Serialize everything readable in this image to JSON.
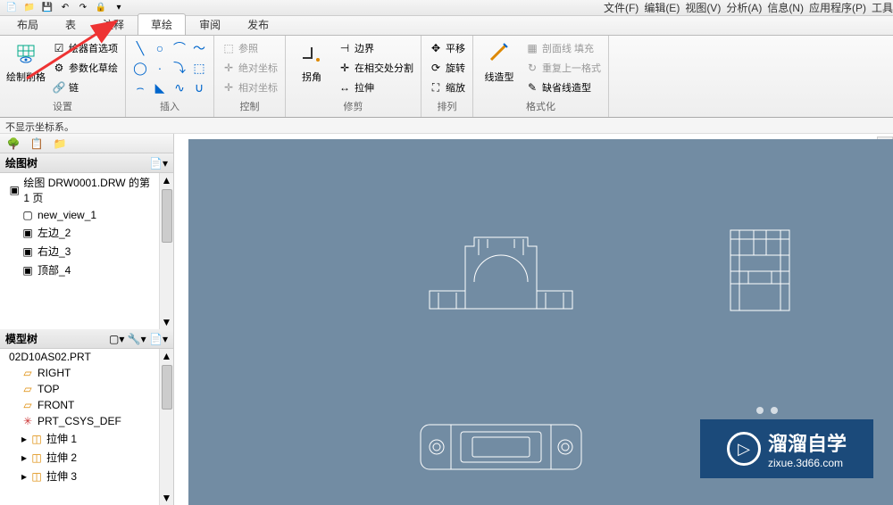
{
  "top_menu": {
    "file": "文件(F)",
    "edit": "编辑(E)",
    "view": "视图(V)",
    "analyze": "分析(A)",
    "info": "信息(N)",
    "app": "应用程序(P)",
    "tool": "工具"
  },
  "tabs": {
    "layout": "布局",
    "table": "表",
    "annot": "注释",
    "sketch": "草绘",
    "review": "审阅",
    "publish": "发布"
  },
  "ribbon": {
    "settings": {
      "title": "设置",
      "sketch_crop": "绘制削格",
      "sketcher_pref": "绘器首选项",
      "param_sketch": "参数化草绘",
      "chain": "链"
    },
    "insert": {
      "title": "插入"
    },
    "control": {
      "title": "控制",
      "ref": "参照",
      "abs_coord": "绝对坐标",
      "rel_coord": "相对坐标"
    },
    "trim": {
      "title": "修剪",
      "corner": "拐角",
      "boundary": "边界",
      "intersect": "在相交处分割",
      "extend": "拉伸"
    },
    "arrange": {
      "title": "排列",
      "translate": "平移",
      "rotate": "旋转",
      "scale": "缩放"
    },
    "format": {
      "title": "格式化",
      "line_style": "线造型",
      "hatch_fill": "剖面线 填充",
      "repeat_fmt": "重复上一格式",
      "default_line": "缺省线造型"
    }
  },
  "status": "不显示坐标系。",
  "sidebar": {
    "drawing_tree": "绘图树",
    "drawing_page": "绘图 DRW0001.DRW 的第 1 页",
    "new_view": "new_view_1",
    "left": "左边_2",
    "right": "右边_3",
    "top_item": "顶部_4",
    "model_tree": "模型树",
    "part_name": "02D10AS02.PRT",
    "right_datum": "RIGHT",
    "top_datum": "TOP",
    "front_datum": "FRONT",
    "csys": "PRT_CSYS_DEF",
    "extrude1": "拉伸 1",
    "extrude2": "拉伸 2",
    "extrude3": "拉伸 3"
  },
  "watermark": {
    "main": "溜溜自学",
    "sub": "zixue.3d66.com"
  }
}
